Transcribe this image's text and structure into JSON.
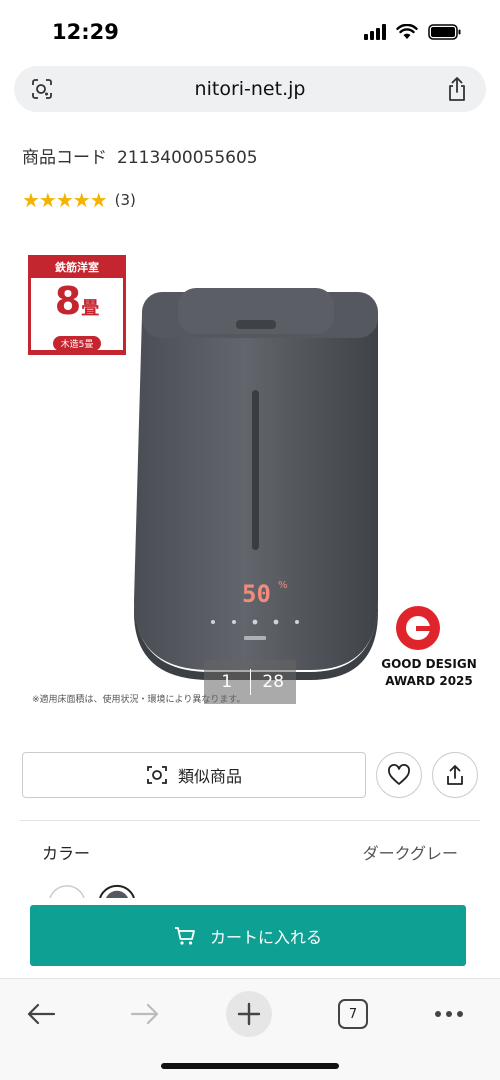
{
  "status_bar": {
    "time": "12:29"
  },
  "browser": {
    "url": "nitori-net.jp",
    "lens_icon": "lens-icon",
    "share_icon": "share-icon"
  },
  "product": {
    "code_label": "商品コード",
    "code_value": "2113400055605",
    "stars": "★★★★★",
    "rating_count": "(3)"
  },
  "image": {
    "badge_top": "鉄筋洋室",
    "badge_number": "8",
    "badge_unit": "畳",
    "badge_sub": "木造5畳",
    "display_reading": "50",
    "display_unit": "%",
    "award_line1": "GOOD DESIGN",
    "award_line2": "AWARD 2025",
    "note": "※適用床面積は、使用状況・環境により異なります。",
    "counter_current": "1",
    "counter_total": "28"
  },
  "actions": {
    "similar_label": "類似商品",
    "favorite_icon": "heart-icon",
    "share_icon": "share-icon"
  },
  "color": {
    "label": "カラー",
    "value": "ダークグレー"
  },
  "cart": {
    "label": "カートに入れる",
    "icon": "cart-icon"
  },
  "bottom_nav": {
    "tab_count": "7"
  },
  "colors": {
    "accent": "#0ea193",
    "badge": "#c42630",
    "star": "#f5b301"
  }
}
